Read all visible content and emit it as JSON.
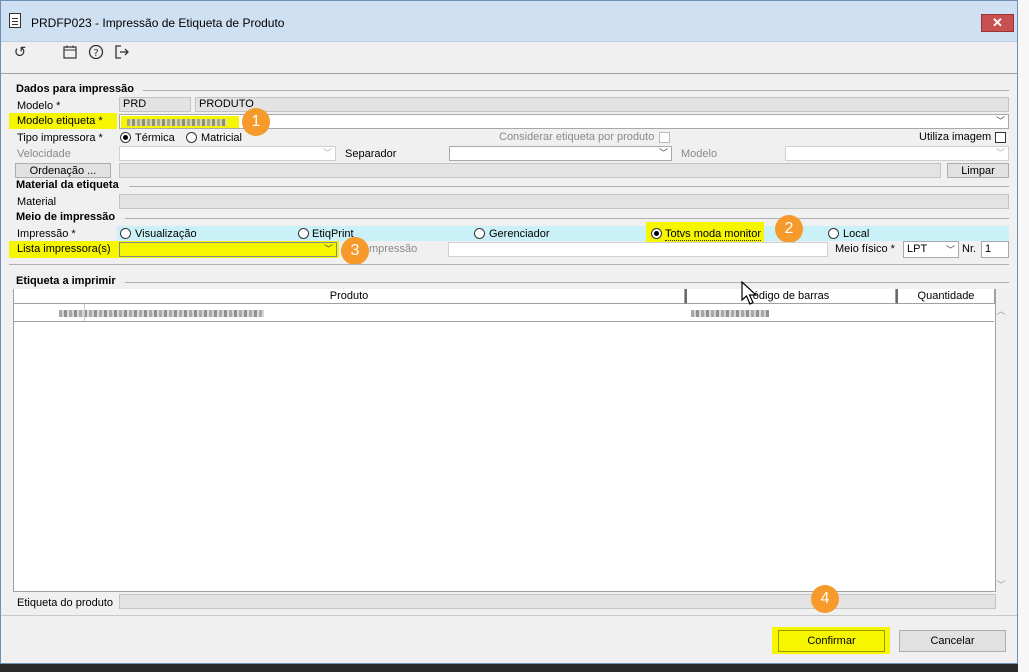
{
  "window": {
    "title": "PRDFP023 - Impressão de Etiqueta de Produto",
    "close_label": "✕"
  },
  "toolbar": {
    "icons": [
      "refresh-icon",
      "calendar-icon",
      "help-icon",
      "exit-icon"
    ]
  },
  "dados": {
    "section_title": "Dados para impressão",
    "modelo_label": "Modelo *",
    "modelo_code": "PRD",
    "modelo_desc": "PRODUTO",
    "modelo_etiqueta_label": "Modelo etiqueta *",
    "tipo_impressora_label": "Tipo impressora *",
    "termica_label": "Térmica",
    "matricial_label": "Matricial",
    "considerar_label": "Considerar etiqueta por produto",
    "utiliza_imagem_label": "Utiliza imagem",
    "velocidade_label": "Velocidade",
    "separador_label": "Separador",
    "modelo2_label": "Modelo",
    "ordenacao_button": "Ordenação ...",
    "limpar_button": "Limpar"
  },
  "material": {
    "section_title": "Material da etiqueta",
    "material_label": "Material"
  },
  "meio": {
    "section_title": "Meio de impressão",
    "impressao_label": "Impressão *",
    "options": {
      "visualizacao": "Visualização",
      "etiqprint": "EtiqPrint",
      "gerenciador": "Gerenciador",
      "totvs": "Totvs moda monitor",
      "local": "Local"
    },
    "lista_label": "Lista impressora(s)",
    "impressao2_label": "mpressão",
    "meio_fisico_label": "Meio físico *",
    "meio_fisico_value": "LPT",
    "nr_label": "Nr.",
    "nr_value": "1"
  },
  "etiqueta": {
    "section_title": "Etiqueta a imprimir",
    "columns": [
      "Produto",
      "ódigo de barras",
      "Quantidade"
    ],
    "etiqueta_produto_label": "Etiqueta do produto"
  },
  "footer": {
    "confirmar": "Confirmar",
    "cancelar": "Cancelar"
  },
  "badges": [
    "1",
    "2",
    "3",
    "4"
  ],
  "colors": {
    "highlight": "#f6f600",
    "badge": "#f59a2b",
    "selected_row": "#c9f1f7"
  }
}
